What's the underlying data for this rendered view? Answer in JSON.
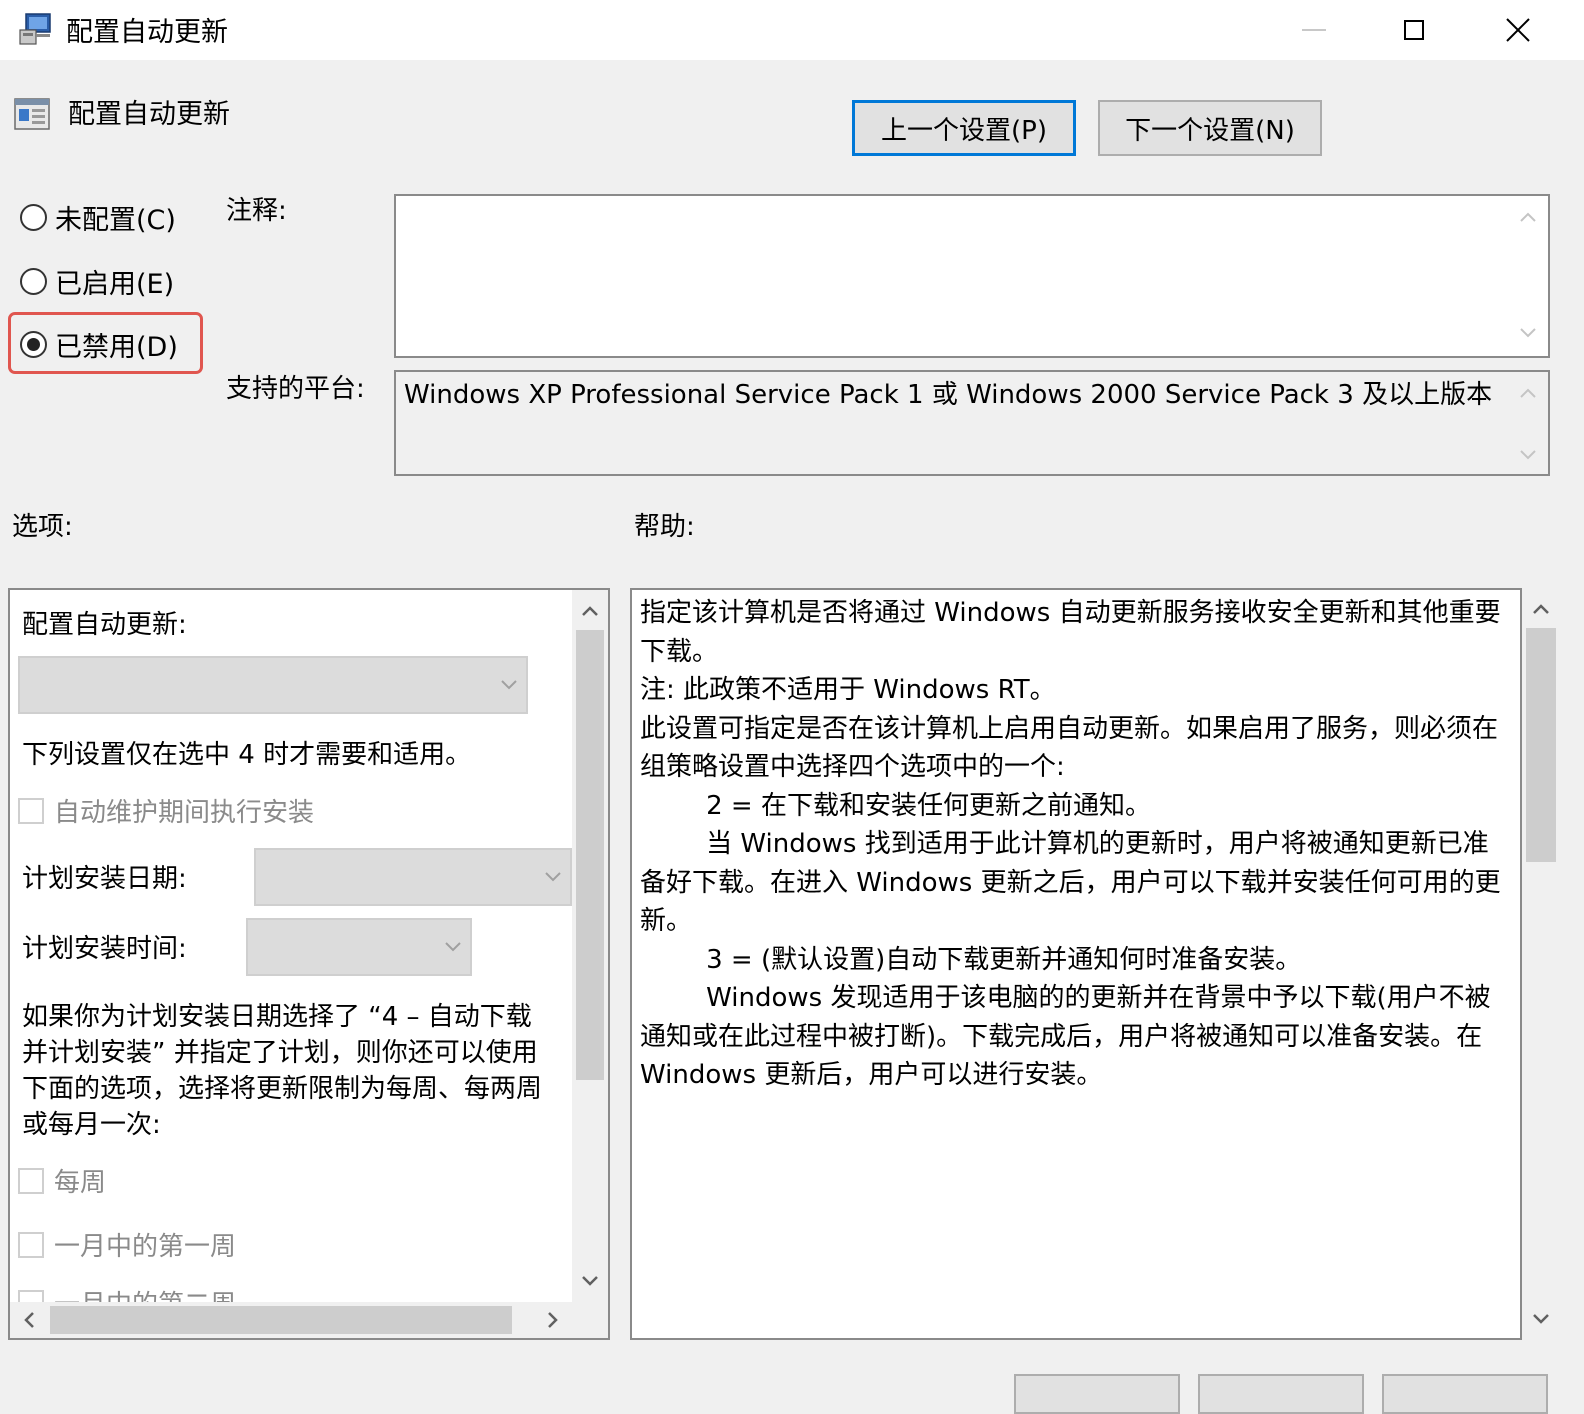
{
  "window": {
    "title": "配置自动更新",
    "minimize_label": "",
    "maximize_label": "",
    "close_label": ""
  },
  "header": {
    "policy_title": "配置自动更新",
    "prev_button": "上一个设置(P)",
    "next_button": "下一个设置(N)"
  },
  "state": {
    "not_configured": "未配置(C)",
    "enabled": "已启用(E)",
    "disabled": "已禁用(D)",
    "selected": "disabled"
  },
  "comment": {
    "label": "注释:",
    "value": ""
  },
  "platform": {
    "label": "支持的平台:",
    "value": "Windows XP Professional Service Pack 1 或 Windows 2000 Service Pack 3 及以上版本"
  },
  "options": {
    "label": "选项:",
    "configure_label": "配置自动更新:",
    "configure_value": "",
    "note_4": "下列设置仅在选中 4 时才需要和适用。",
    "auto_maintenance": "自动维护期间执行安装",
    "schedule_day_label": "计划安装日期:",
    "schedule_day_value": "",
    "schedule_time_label": "计划安装时间:",
    "schedule_time_value": "",
    "extra_desc_lines": [
      "如果你为计划安装日期选择了 “4 – 自动下载",
      "并计划安装” 并指定了计划，则你还可以使用",
      "下面的选项，选择将更新限制为每周、每两周",
      "或每月一次:"
    ],
    "weekly": "每周",
    "first_week": "一月中的第一周",
    "second_week": "一月中的第二周"
  },
  "help": {
    "label": "帮助:",
    "paragraphs": [
      "指定该计算机是否将通过 Windows 自动更新服务接收安全更新和其他重要下载。",
      "",
      "注: 此政策不适用于 Windows RT。",
      "",
      "此设置可指定是否在该计算机上启用自动更新。如果启用了服务，则必须在组策略设置中选择四个选项中的一个:",
      "",
      "        2 = 在下载和安装任何更新之前通知。",
      "",
      "        当 Windows 找到适用于此计算机的更新时，用户将被通知更新已准备好下载。在进入 Windows 更新之后，用户可以下载并安装任何可用的更新。",
      "",
      "        3 = (默认设置)自动下载更新并通知何时准备安装。",
      "",
      "        Windows 发现适用于该电脑的的更新并在背景中予以下载(用户不被通知或在此过程中被打断)。下载完成后，用户将被通知可以准备安装。在 Windows 更新后，用户可以进行安装。"
    ]
  },
  "colors": {
    "accent": "#0078d7",
    "highlight": "#e0564f"
  }
}
